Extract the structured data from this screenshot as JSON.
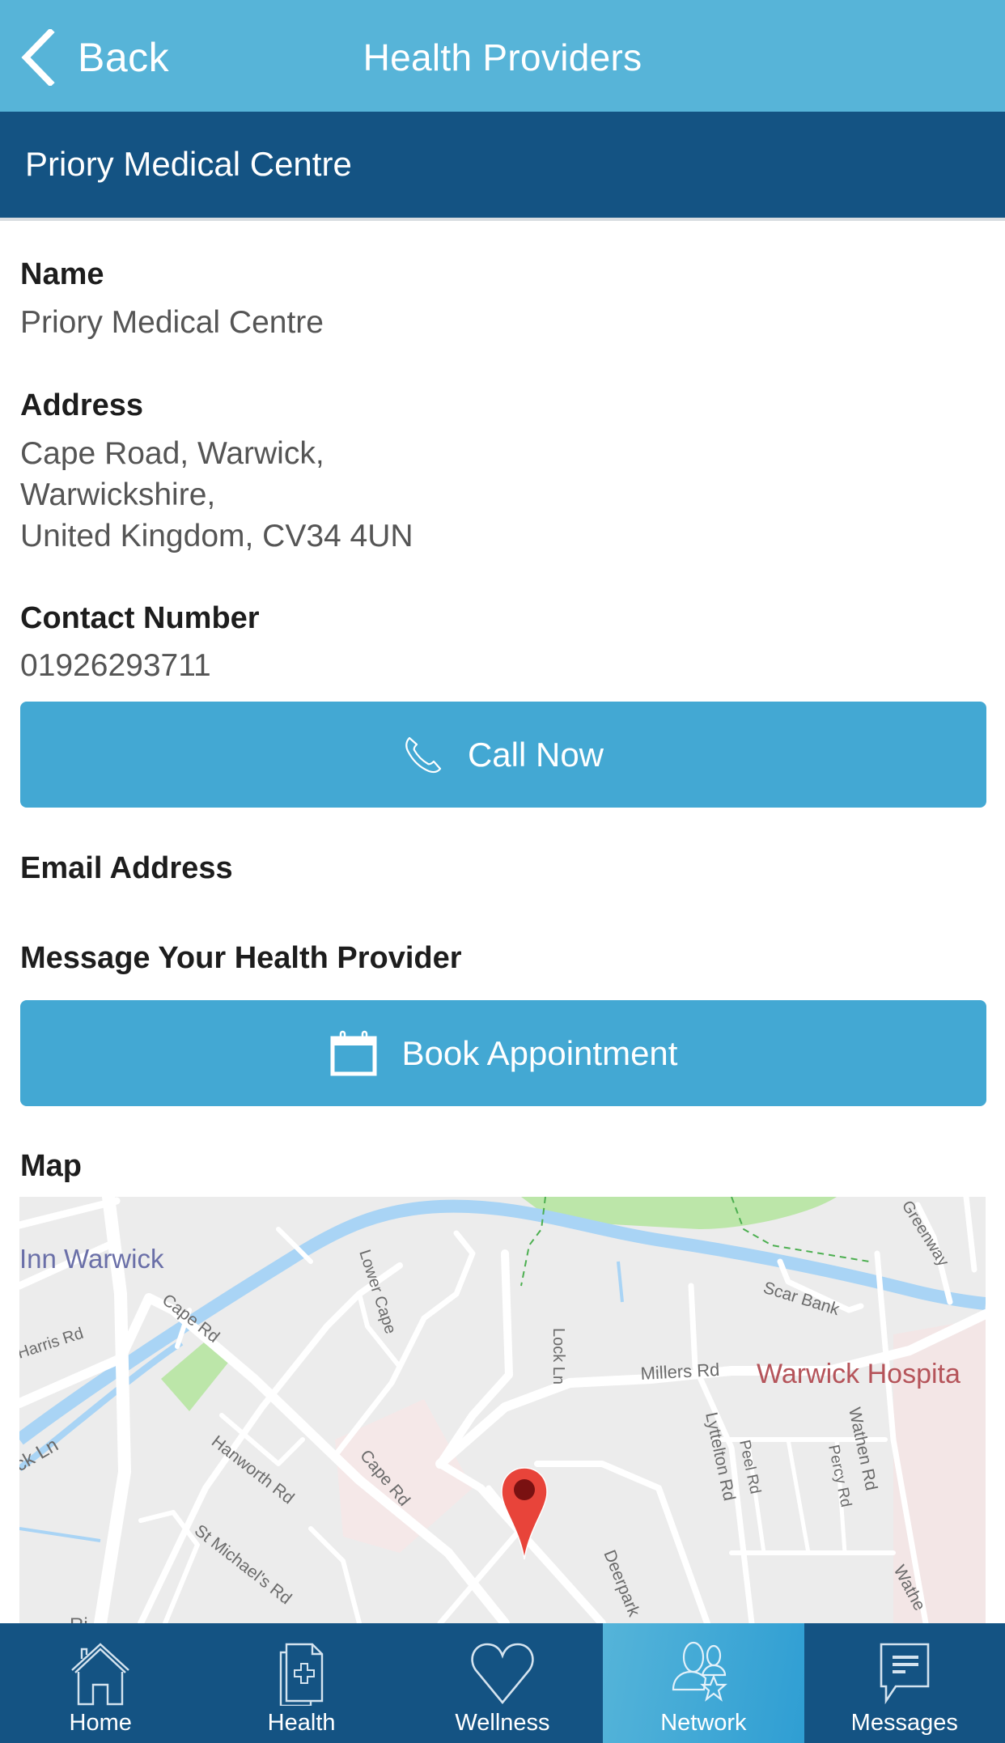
{
  "navbar": {
    "back_label": "Back",
    "title": "Health Providers"
  },
  "subheader": {
    "title": "Priory Medical Centre"
  },
  "details": {
    "name_label": "Name",
    "name_value": "Priory Medical Centre",
    "address_label": "Address",
    "address_lines": [
      "Cape Road, Warwick,",
      "Warwickshire,",
      "United Kingdom, CV34 4UN"
    ],
    "contact_label": "Contact Number",
    "contact_value": "01926293711",
    "call_button_label": "Call Now",
    "email_label": "Email Address",
    "message_label": "Message Your Health Provider",
    "book_button_label": "Book Appointment",
    "map_label": "Map"
  },
  "map": {
    "labels": {
      "inn_warwick": "Inn Warwick",
      "harris_rd": "Harris Rd",
      "cape_rd_1": "Cape Rd",
      "cape_rd_2": "Cape Rd",
      "lower_cape": "Lower Cape",
      "lock_ln_1": "Lock Ln",
      "lock_ln_2": "ck Ln",
      "millers_rd": "Millers Rd",
      "warwick_hospital": "Warwick Hospita",
      "scar_bank": "Scar Bank",
      "greenway": "Greenway",
      "hanworth_rd": "Hanworth Rd",
      "st_michaels_rd": "St Michael's Rd",
      "lyttelton_rd": "Lyttelton Rd",
      "peel_rd": "Peel Rd",
      "percy_rd": "Percy Rd",
      "wathen_rd_1": "Wathen Rd",
      "wathen_rd_2": "Wathe",
      "deerpark": "Deerpark",
      "ri_fragment": "Ri"
    },
    "colors": {
      "land": "#ececec",
      "road": "#ffffff",
      "water": "#a9d4f5",
      "park": "#bce6a9",
      "hospital_area": "#f5e4e4",
      "hospital_label": "#b5545a",
      "poi_label": "#6a6fa8",
      "pin": "#e8443a",
      "pin_dot": "#7a1111"
    }
  },
  "tabbar": {
    "active_index": 3,
    "items": [
      {
        "label": "Home",
        "icon": "home-icon"
      },
      {
        "label": "Health",
        "icon": "health-record-icon"
      },
      {
        "label": "Wellness",
        "icon": "heart-icon"
      },
      {
        "label": "Network",
        "icon": "network-icon"
      },
      {
        "label": "Messages",
        "icon": "messages-icon"
      }
    ]
  },
  "colors": {
    "navbar_bg": "#57b4d8",
    "subheader_bg": "#145383",
    "button_bg": "#43a8d3",
    "tabbar_bg": "#145383"
  }
}
